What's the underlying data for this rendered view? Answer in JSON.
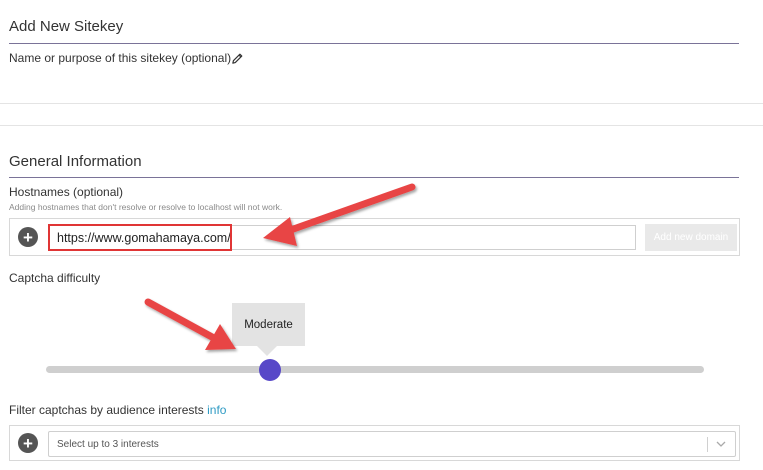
{
  "header": {
    "title": "Add New Sitekey"
  },
  "name_field": {
    "label": "Name or purpose of this sitekey (optional)",
    "icon": "pencil-icon"
  },
  "general": {
    "title": "General Information"
  },
  "hostnames": {
    "label": "Hostnames (optional)",
    "hint": "Adding hostnames that don't resolve or resolve to localhost will not work.",
    "value": "https://www.gomahamaya.com/",
    "add_button": "Add new domain"
  },
  "difficulty": {
    "label": "Captcha difficulty",
    "tooltip": "Moderate",
    "level_fraction": 0.34
  },
  "interests": {
    "label": "Filter captchas by audience interests",
    "info_link": "info",
    "placeholder": "Select up to 3 interests"
  },
  "colors": {
    "accent": "#5748c8",
    "link": "#2f9bc4",
    "annotation": "#e03535"
  }
}
